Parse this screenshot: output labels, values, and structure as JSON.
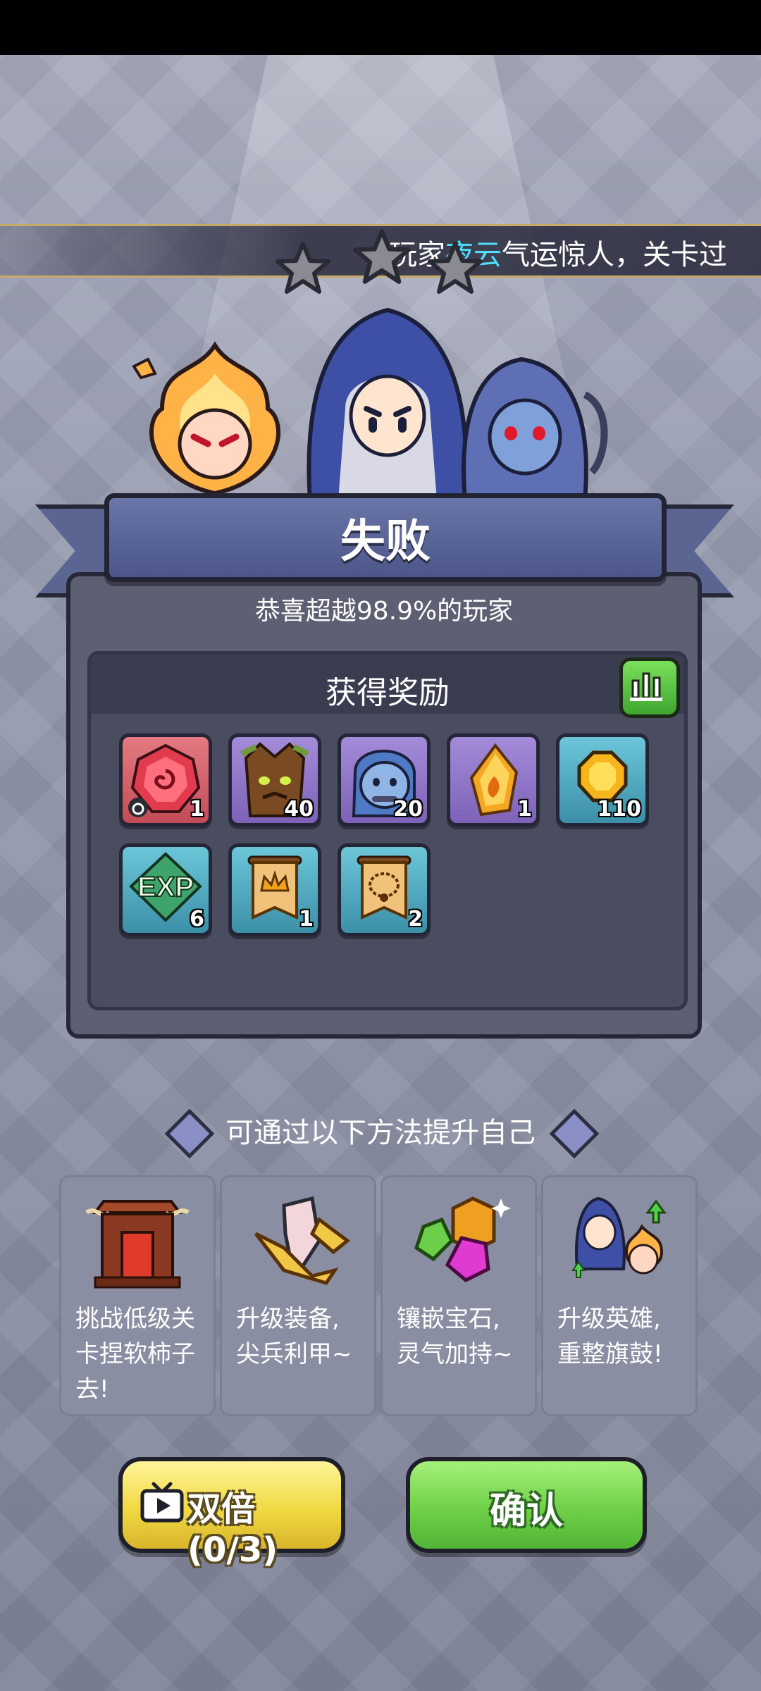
{
  "marquee": {
    "prefix": "玩家",
    "player": "夜云",
    "suffix": "气运惊人，关卡过"
  },
  "result": {
    "title": "失败",
    "subtitle": "恭喜超越98.9%的玩家",
    "stars_earned": 0,
    "stars_total": 3
  },
  "rewards": {
    "title": "获得奖励",
    "items": [
      {
        "icon": "red-gem-icon",
        "count": "1"
      },
      {
        "icon": "tree-hero-icon",
        "count": "40"
      },
      {
        "icon": "blue-hero-icon",
        "count": "20"
      },
      {
        "icon": "amber-crystal-icon",
        "count": "1"
      },
      {
        "icon": "gold-coin-icon",
        "count": "110"
      },
      {
        "icon": "exp-icon",
        "count": "6",
        "label": "EXP"
      },
      {
        "icon": "crown-scroll-icon",
        "count": "1"
      },
      {
        "icon": "necklace-scroll-icon",
        "count": "2"
      }
    ]
  },
  "tips": {
    "title": "可通过以下方法提升自己",
    "cards": [
      {
        "icon": "shrine-icon",
        "text": "挑战低级关卡捏软柿子去!"
      },
      {
        "icon": "equipment-icon",
        "text": "升级装备,尖兵利甲~"
      },
      {
        "icon": "gems-icon",
        "text": "镶嵌宝石,灵气加持~"
      },
      {
        "icon": "hero-upgrade-icon",
        "text": "升级英雄,重整旗鼓!"
      }
    ]
  },
  "buttons": {
    "double": "双倍(0/3)",
    "confirm": "确认"
  },
  "colors": {
    "player_highlight": "#4fe0ff",
    "banner": "#5b6592",
    "confirm": "#6fd048",
    "double": "#f1d943"
  }
}
